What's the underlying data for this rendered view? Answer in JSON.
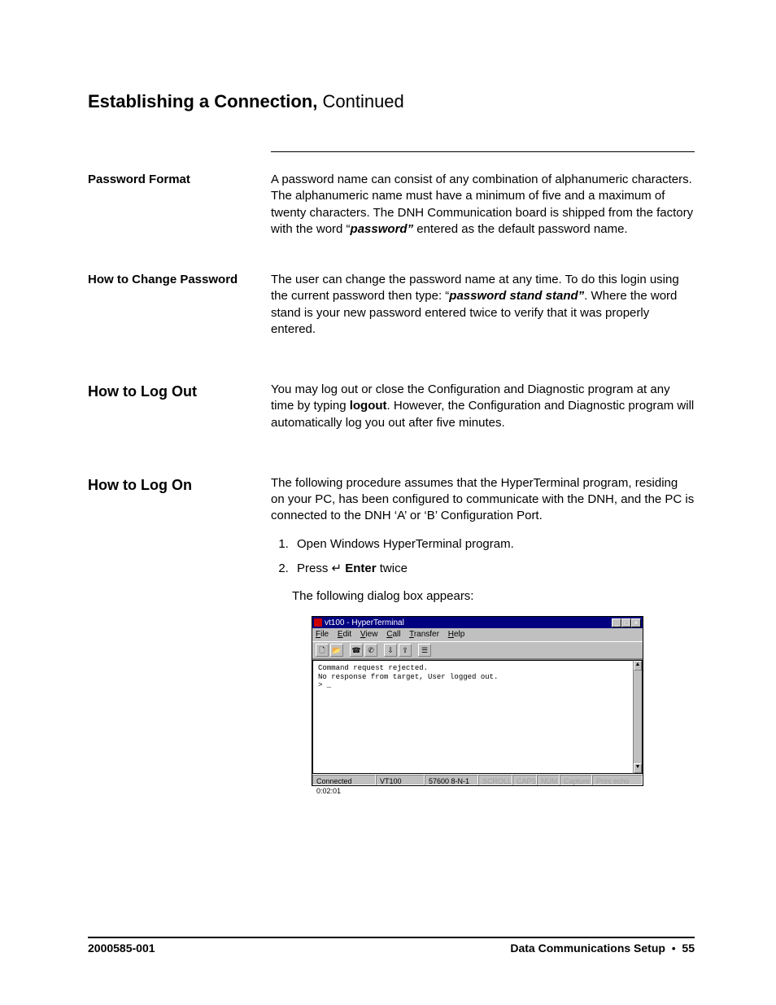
{
  "title": {
    "main": "Establishing a Connection,",
    "sub": " Continued"
  },
  "sections": {
    "password_format": {
      "label": "Password Format",
      "text_pre": "A password name can consist of any combination of alphanumeric characters. The alphanumeric name must have a minimum of five and a maximum of twenty characters. The DNH Communication board is shipped from the factory with the word “",
      "bold": "password”",
      "text_post": " entered as the default password name."
    },
    "change_password": {
      "label": "How to Change Password",
      "text_pre": "The user can change the password name at any time. To do this login using the current password then type: “",
      "bold": "password stand stand”",
      "text_post": ". Where the word stand is your new password entered twice to verify that it was properly entered."
    },
    "log_out": {
      "label": "How to Log Out",
      "text_pre": "You may log out or close the Configuration and Diagnostic program at any time by typing ",
      "bold": "logout",
      "text_post": ". However, the Configuration and Diagnostic program will automatically log you out after five minutes."
    },
    "log_on": {
      "label": "How to Log On",
      "intro": "The following procedure assumes that the HyperTerminal program, residing on your PC, has been configured to communicate with the DNH, and the PC is connected to the DNH ‘A’ or ‘B’ Configuration Port.",
      "steps": {
        "s1": "Open Windows HyperTerminal program.",
        "s2_pre": "Press ↵ ",
        "s2_bold": "Enter",
        "s2_post": " twice"
      },
      "after_steps": "The following dialog box appears:"
    }
  },
  "hyperterminal": {
    "title": "vt100 - HyperTerminal",
    "menu": {
      "file": "File",
      "edit": "Edit",
      "view": "View",
      "call": "Call",
      "transfer": "Transfer",
      "help": "Help"
    },
    "terminal_text": "Command request rejected.\nNo response from target, User logged out.\n> _",
    "status": {
      "connected": "Connected 0:02:01",
      "emul": "VT100",
      "params": "57600 8-N-1",
      "scroll": "SCROLL",
      "caps": "CAPS",
      "num": "NUM",
      "capture": "Capture",
      "print": "Print echo"
    }
  },
  "footer": {
    "doc_number": "2000585-001",
    "section": "Data Communications Setup",
    "bullet": "•",
    "page": "55"
  }
}
